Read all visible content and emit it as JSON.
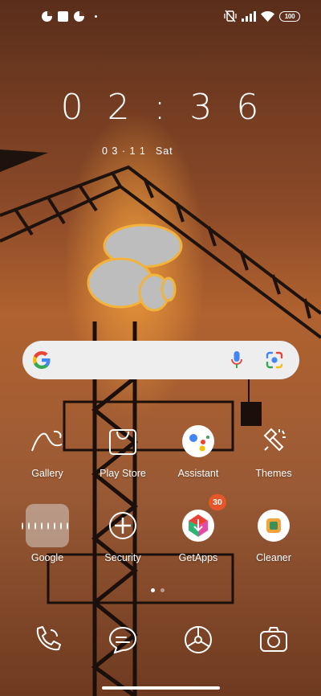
{
  "status_bar": {
    "left_icons": [
      "notification-pie-icon",
      "notification-square-icon",
      "notification-pie-icon",
      "dot-icon"
    ],
    "right_icons": [
      "vibrate-off-icon",
      "signal-icon",
      "wifi-icon"
    ],
    "battery": "100"
  },
  "clock": {
    "time": "0 2 : 3 6",
    "date": "0 3 · 1 1",
    "day": "Sat"
  },
  "search": {
    "logo": "google-g-icon",
    "mic": "mic-icon",
    "lens": "lens-icon"
  },
  "apps": [
    {
      "label": "Gallery",
      "icon": "gallery-icon"
    },
    {
      "label": "Play Store",
      "icon": "play-store-icon"
    },
    {
      "label": "Assistant",
      "icon": "assistant-icon"
    },
    {
      "label": "Themes",
      "icon": "themes-icon"
    },
    {
      "label": "Google",
      "icon": "folder-icon"
    },
    {
      "label": "Security",
      "icon": "security-icon"
    },
    {
      "label": "GetApps",
      "icon": "getapps-icon",
      "badge": "30"
    },
    {
      "label": "Cleaner",
      "icon": "cleaner-icon"
    }
  ],
  "pager": {
    "pages": 2,
    "current": 1
  },
  "dock": [
    "phone-icon",
    "messages-icon",
    "browser-icon",
    "camera-icon"
  ],
  "colors": {
    "wallpaper_top": "#5a2e1b",
    "wallpaper_mid": "#b0622f",
    "badge": "#e5572b",
    "searchbar": "#eeeeef"
  }
}
